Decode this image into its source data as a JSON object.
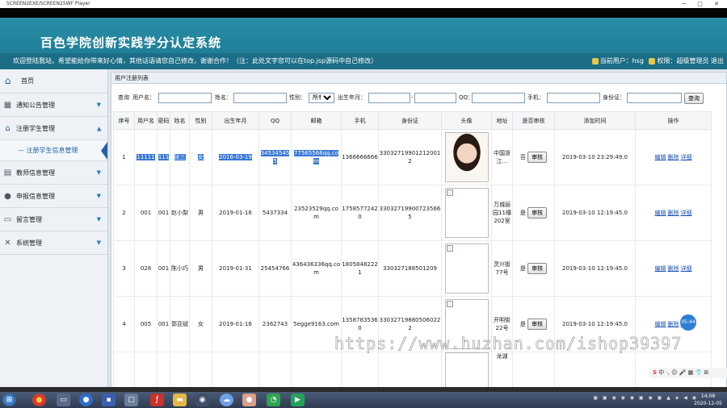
{
  "player": {
    "title": "SCREEN2EXE/SCREEN2SWF Player",
    "controls": "─ □ ✕"
  },
  "app": {
    "title": "百色学院创新实践学分认定系统",
    "welcome": "欢迎登陆我站，希望能给你带来好心情，其他话语请您自己修改，谢谢合作！（注：此处文字您可以在top.jsp源码中自己修改）",
    "current_user_label": "当前用户：hsg",
    "permission_label": "权限：超级管理员",
    "logout_label": "退出"
  },
  "sidebar": {
    "home": "首页",
    "items": [
      {
        "label": "通知公告管理",
        "icon": "grid-icon"
      },
      {
        "label": "注册学生管理",
        "icon": "house-icon",
        "active": true
      },
      {
        "label": "教师信息管理",
        "icon": "folder-icon"
      },
      {
        "label": "申报信息管理",
        "icon": "person-icon"
      },
      {
        "label": "留言管理",
        "icon": "doc-icon"
      },
      {
        "label": "系统管理",
        "icon": "tools-icon"
      }
    ],
    "sub_item": "注册学生信息管理"
  },
  "panel": {
    "title": "用户注册列表",
    "search": {
      "query_label": "查询",
      "username_label": "用户名：",
      "name_label": "姓名：",
      "gender_label": "性别：",
      "gender_value": "所有",
      "birth_label": "出生年月：",
      "birth_sep": "-",
      "qq_label": "QQ：",
      "phone_label": "手机：",
      "idcard_label": "身份证：",
      "search_button": "查询"
    },
    "columns": [
      "序号",
      "用户名",
      "密码",
      "姓名",
      "性别",
      "出生年月",
      "QQ",
      "邮箱",
      "手机",
      "身份证",
      "头像",
      "地址",
      "是否审核",
      "添加时间",
      "操作"
    ],
    "audit_button": "审核",
    "ops": [
      "编辑",
      "删除",
      "详细"
    ],
    "rows": [
      {
        "no": "1",
        "username": "11111",
        "password": "111",
        "name": "张三",
        "gender": "女",
        "birth": "2016-03-19",
        "qq": "345345455",
        "email": "77565566qq.com",
        "phone": "1366666666",
        "idcard": "330327199012120012",
        "address": "中国浙江…",
        "audited": "否",
        "added": "2019-03-10 23:29:49.0",
        "photo": "real"
      },
      {
        "no": "2",
        "username": "001",
        "password": "001",
        "name": "赵小梨",
        "gender": "男",
        "birth": "2019-01-16",
        "qq": "5437334",
        "email": "23523529qq.com",
        "phone": "17585772420",
        "idcard": "330327199007235665",
        "address": "万城丽园11幢202室",
        "audited": "是",
        "added": "2019-03-10 12:19:45.0",
        "photo": "broken"
      },
      {
        "no": "3",
        "username": "028",
        "password": "001",
        "name": "陈小巧",
        "gender": "男",
        "birth": "2019-01-31",
        "qq": "25454766",
        "email": "436436336qq.com",
        "phone": "18058482221",
        "idcard": "330327188501209",
        "address": "灵兴街77号",
        "audited": "是",
        "added": "2019-03-10 12:19:45.0",
        "photo": "broken"
      },
      {
        "no": "4",
        "username": "005",
        "password": "001",
        "name": "郭亚斌",
        "gender": "女",
        "birth": "2019-01-16",
        "qq": "2362743",
        "email": "5egge9163.com",
        "phone": "13587835360",
        "idcard": "330327198805060222",
        "address": "开明街22号",
        "audited": "是",
        "added": "2019-03-10 12:19:45.0",
        "photo": "broken"
      }
    ],
    "partial_row_address": "龙湖"
  },
  "overlay": {
    "watermark": "https://www.huzhan.com/ishop39397",
    "badge": "05:44",
    "ime": "中 ·, ☺ 🎤 ▦ 👕 ⊞"
  },
  "taskbar": {
    "time": "14:08",
    "date": "2020-12-05"
  }
}
